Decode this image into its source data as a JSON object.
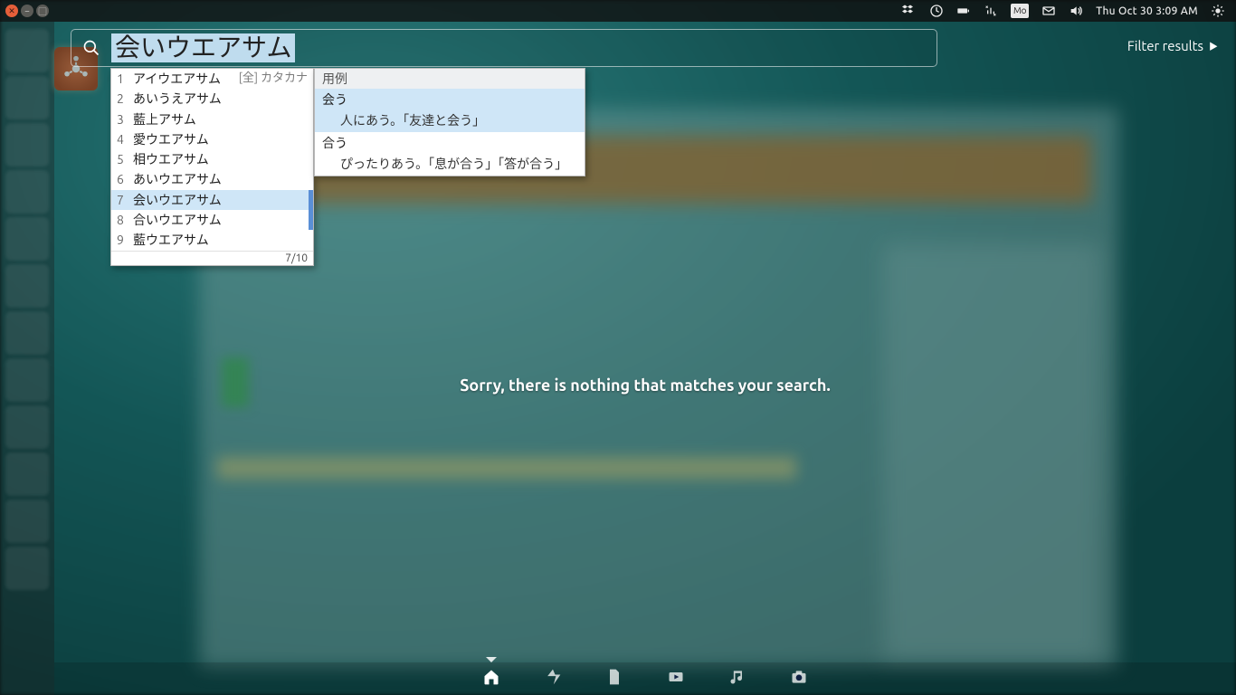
{
  "panel": {
    "clock": "Thu Oct 30  3:09 AM",
    "keyboard_indicator": "Mo"
  },
  "dash": {
    "search_query": "会いウエアサム",
    "filter_label": "Filter results",
    "no_results": "Sorry, there is nothing that matches your search."
  },
  "ime": {
    "mode_hint_bracket": "[全]",
    "mode_hint": "カタカナ",
    "page": "7/10",
    "candidates": [
      {
        "n": "1",
        "text": "アイウエアサム"
      },
      {
        "n": "2",
        "text": "あいうえアサム"
      },
      {
        "n": "3",
        "text": "藍上アサム"
      },
      {
        "n": "4",
        "text": "愛ウエアサム"
      },
      {
        "n": "5",
        "text": "相ウエアサム"
      },
      {
        "n": "6",
        "text": "あいウエアサム"
      },
      {
        "n": "7",
        "text": "会いウエアサム"
      },
      {
        "n": "8",
        "text": "合いウエアサム"
      },
      {
        "n": "9",
        "text": "藍ウエアサム"
      }
    ],
    "selected_index": 6,
    "examples": {
      "header": "用例",
      "groups": [
        {
          "word": "会う",
          "sentence": "人にあう。「友達と会う」",
          "selected": true
        },
        {
          "word": "合う",
          "sentence": "ぴったりあう。「息が合う」「答が合う」",
          "selected": false
        }
      ]
    }
  },
  "lenses": [
    "home",
    "applications",
    "files",
    "video",
    "music",
    "photos"
  ],
  "launcher_items": [
    "dash",
    "files",
    "web",
    "writer",
    "calc",
    "impress",
    "settings",
    "security",
    "firefox",
    "terminal",
    "software",
    "trash",
    "dev"
  ]
}
